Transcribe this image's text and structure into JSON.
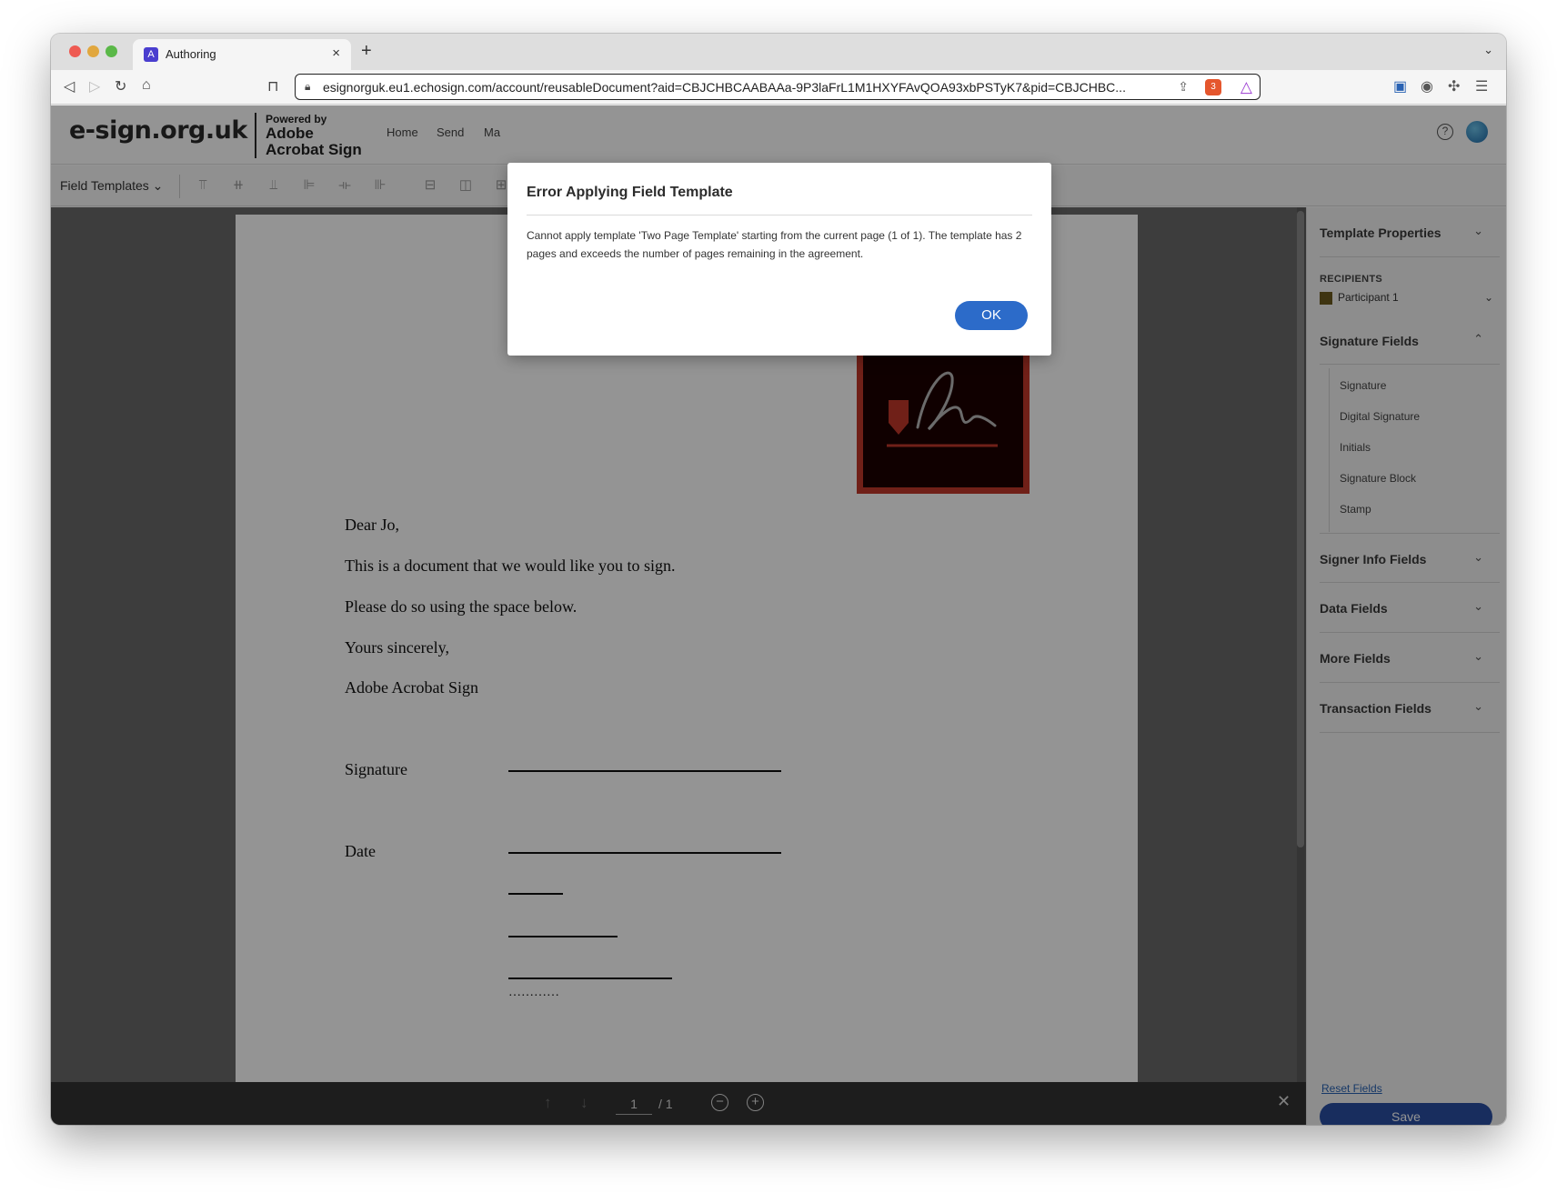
{
  "browser": {
    "tab_title": "Authoring",
    "tab_close": "×",
    "new_tab": "+",
    "url": "esignorguk.eu1.echosign.com/account/reusableDocument?aid=CBJCHBCAABAAa-9P3laFrL1M1HXYFAvQOA93xbPSTyK7&pid=CBJCHBC..."
  },
  "app": {
    "logo": "e-sign.org.uk",
    "powered_by": "Powered by",
    "brand": "Adobe Acrobat Sign",
    "nav": [
      "Home",
      "Send",
      "Ma"
    ],
    "help": "?"
  },
  "toolbar": {
    "field_templates": "Field Templates ⌄"
  },
  "document": {
    "greeting": "Dear Jo,",
    "line1": "This is a document that we would like you to sign.",
    "line2": "Please do so using the space below.",
    "closing": "Yours sincerely,",
    "sender": "Adobe Acrobat Sign",
    "signature_label": "Signature",
    "date_label": "Date",
    "dots": "…………"
  },
  "pager": {
    "current": "1",
    "total": "/ 1"
  },
  "panel": {
    "template_properties": "Template Properties",
    "recipients_label": "RECIPIENTS",
    "participant": "Participant 1",
    "participant_color": "#6b5a1e",
    "signature_fields": "Signature Fields",
    "signature_items": [
      "Signature",
      "Digital Signature",
      "Initials",
      "Signature Block",
      "Stamp"
    ],
    "signer_info_fields": "Signer Info Fields",
    "data_fields": "Data Fields",
    "more_fields": "More Fields",
    "transaction_fields": "Transaction Fields",
    "reset_fields": "Reset Fields",
    "save": "Save"
  },
  "modal": {
    "title": "Error Applying Field Template",
    "message": "Cannot apply template 'Two Page Template' starting from the current page (1 of 1). The template has 2 pages and exceeds the number of pages remaining in the agreement.",
    "ok": "OK"
  },
  "colors": {
    "accent": "#2c6bc9",
    "save": "#2a4fa3",
    "logo_red": "#c2372a"
  }
}
